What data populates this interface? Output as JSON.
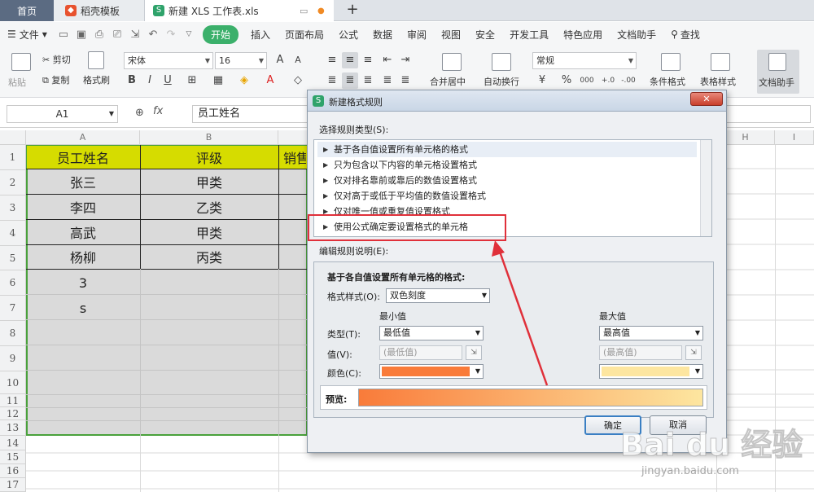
{
  "tabs": {
    "home": "首页",
    "templates": "稻壳模板",
    "document": "新建 XLS 工作表.xls",
    "new_tab": "+"
  },
  "menu": {
    "file": "文件",
    "items": [
      "开始",
      "插入",
      "页面布局",
      "公式",
      "数据",
      "审阅",
      "视图",
      "安全",
      "开发工具",
      "特色应用",
      "文档助手"
    ],
    "search": "查找"
  },
  "ribbon": {
    "paste": "粘贴",
    "cut": "剪切",
    "copy": "复制",
    "format_painter": "格式刷",
    "font_name": "宋体",
    "font_size": "16",
    "merge_center": "合并居中",
    "wrap_text": "自动换行",
    "number_format": "常规",
    "conditional_format": "条件格式",
    "table_style": "表格样式",
    "doc_assistant": "文档助手",
    "bold": "B",
    "italic": "I",
    "underline": "U",
    "grow_font": "A",
    "shrink_font": "A",
    "percent": "%",
    "comma": "000",
    "inc_decimal": "+.0",
    "dec_decimal": "-.00"
  },
  "formula_bar": {
    "name_box": "A1",
    "fx": "fx",
    "content": "员工姓名"
  },
  "sheet": {
    "columns": [
      "A",
      "B",
      "H",
      "I"
    ],
    "rows": [
      "1",
      "2",
      "3",
      "4",
      "5",
      "6",
      "7",
      "8",
      "9",
      "10",
      "11",
      "12",
      "13",
      "14",
      "15",
      "16",
      "17"
    ],
    "header": [
      "员工姓名",
      "评级",
      "销售"
    ],
    "data": [
      [
        "张三",
        "甲类"
      ],
      [
        "李四",
        "乙类"
      ],
      [
        "高武",
        "甲类"
      ],
      [
        "杨柳",
        "丙类"
      ],
      [
        "3",
        ""
      ],
      [
        "s",
        ""
      ]
    ],
    "highlight_color": "#d6dc00",
    "selection_color": "#dadada"
  },
  "dialog": {
    "title": "新建格式规则",
    "select_rule_label": "选择规则类型(S):",
    "rules": [
      "基于各自值设置所有单元格的格式",
      "只为包含以下内容的单元格设置格式",
      "仅对排名靠前或靠后的数值设置格式",
      "仅对高于或低于平均值的数值设置格式",
      "仅对唯一值或重复值设置格式",
      "使用公式确定要设置格式的单元格"
    ],
    "edit_rule_label": "编辑规则说明(E):",
    "section_title": "基于各自值设置所有单元格的格式:",
    "format_style_label": "格式样式(O):",
    "format_style_value": "双色刻度",
    "min_label": "最小值",
    "max_label": "最大值",
    "type_label": "类型(T):",
    "min_type": "最低值",
    "max_type": "最高值",
    "value_label": "值(V):",
    "min_value_placeholder": "(最低值)",
    "max_value_placeholder": "(最高值)",
    "color_label": "颜色(C):",
    "min_color": "#f97b3a",
    "max_color": "#fde6a0",
    "preview_label": "预览:",
    "ok_button": "确定",
    "cancel_button": "取消"
  },
  "watermark": {
    "brand": "Bai du 经验",
    "url": "jingyan.baidu.com"
  }
}
